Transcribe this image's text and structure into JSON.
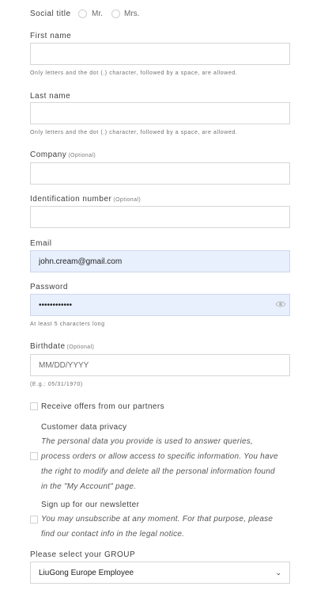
{
  "social_title": {
    "label": "Social title",
    "options": [
      "Mr.",
      "Mrs."
    ]
  },
  "first_name": {
    "label": "First name",
    "value": "",
    "hint": "Only letters and the dot (.) character, followed by a space, are allowed."
  },
  "last_name": {
    "label": "Last name",
    "value": "",
    "hint": "Only letters and the dot (.) character, followed by a space, are allowed."
  },
  "company": {
    "label": "Company",
    "optional": "(Optional)",
    "value": ""
  },
  "identification": {
    "label": "Identification number",
    "optional": "(Optional)",
    "value": ""
  },
  "email": {
    "label": "Email",
    "value": "john.cream@gmail.com"
  },
  "password": {
    "label": "Password",
    "value": "••••••••••••",
    "hint": "At least 5 characters long",
    "icon": "eye-icon"
  },
  "birthdate": {
    "label": "Birthdate",
    "optional": "(Optional)",
    "placeholder": "MM/DD/YYYY",
    "hint": "(E.g.: 05/31/1970)"
  },
  "offers": {
    "label": "Receive offers from our partners"
  },
  "privacy": {
    "title": "Customer data privacy",
    "lines": [
      "The personal data you provide is used to answer queries,",
      "process orders or allow access to specific information. You have",
      "the right to modify and delete all the personal information found",
      "in the \"My Account\" page."
    ]
  },
  "newsletter": {
    "title": "Sign up for our newsletter",
    "lines": [
      "You may unsubscribe at any moment. For that purpose, please",
      "find our contact info in the legal notice."
    ]
  },
  "group": {
    "label": "Please select your GROUP",
    "selected": "LiuGong Europe Employee"
  }
}
